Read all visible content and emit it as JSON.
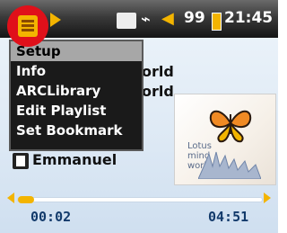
{
  "status": {
    "volume": "99",
    "time": "21:45"
  },
  "menu": {
    "items": [
      {
        "label": "Setup",
        "selected": true
      },
      {
        "label": "Info",
        "selected": false
      },
      {
        "label": "ARCLibrary",
        "selected": false
      },
      {
        "label": "Edit Playlist",
        "selected": false
      },
      {
        "label": "Set Bookmark",
        "selected": false
      }
    ]
  },
  "track": {
    "background_text_1": "orld",
    "background_text_2": "orld",
    "title": "Emmanuel",
    "album_caption": "Lotus\nmind\nworld"
  },
  "playback": {
    "elapsed": "00:02",
    "total": "04:51",
    "progress_fraction": 0.01
  },
  "colors": {
    "accent": "#f3b400",
    "highlight_circle": "#e0101a",
    "menu_bg": "#1a1a1a",
    "menu_selected_bg": "#a7a7a7"
  },
  "icons": {
    "menu": "menu-icon",
    "play_arrow": "play-arrow-icon",
    "bookmark": "bookmark-icon",
    "headphone": "headphone-icon",
    "speaker": "speaker-icon",
    "battery": "battery-icon",
    "track": "track-icon"
  }
}
